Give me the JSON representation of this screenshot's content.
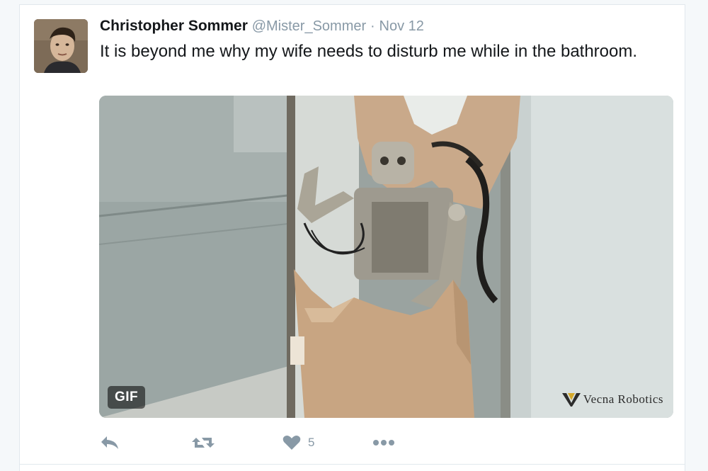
{
  "tweet": {
    "author_name": "Christopher Sommer",
    "author_handle": "@Mister_Sommer",
    "separator": "·",
    "date": "Nov 12",
    "text": "It is beyond me why my wife needs to disturb me while in the bathroom.",
    "avatar_icon": "user-avatar-photo"
  },
  "media": {
    "badge": "GIF",
    "watermark": "Vecna Robotics",
    "description_icon": "robot-breaking-door-image"
  },
  "actions": {
    "reply_icon": "reply-icon",
    "retweet_icon": "retweet-icon",
    "like_icon": "heart-icon",
    "like_count": "5",
    "more_icon": "more-dots-icon"
  },
  "colors": {
    "text": "#14171a",
    "muted": "#8899a6",
    "border": "#e1e8ed",
    "page_bg": "#f5f8fa"
  }
}
